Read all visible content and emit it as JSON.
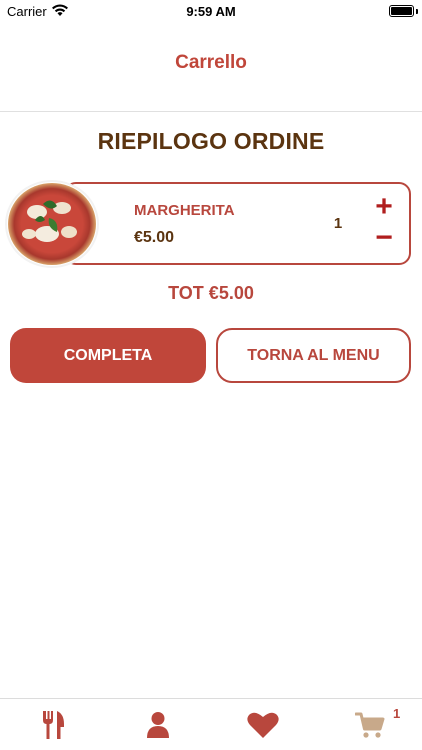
{
  "status_bar": {
    "carrier": "Carrier",
    "time": "9:59 AM"
  },
  "nav": {
    "title": "Carrello"
  },
  "summary": {
    "title": "RIEPILOGO ORDINE"
  },
  "cart_items": [
    {
      "name": "MARGHERITA",
      "price": "€5.00",
      "quantity": "1",
      "increase_label": "+",
      "decrease_label": "−"
    }
  ],
  "total": "TOT €5.00",
  "actions": {
    "complete_label": "COMPLETA",
    "back_label": "TORNA AL MENU"
  },
  "tab_bar": {
    "cart_badge": "1",
    "icons": [
      "fork-knife-icon",
      "person-icon",
      "heart-icon",
      "cart-icon"
    ]
  },
  "colors": {
    "accent": "#c0463a",
    "brown": "#5b3410",
    "inactive_tab": "#c8a98a"
  }
}
